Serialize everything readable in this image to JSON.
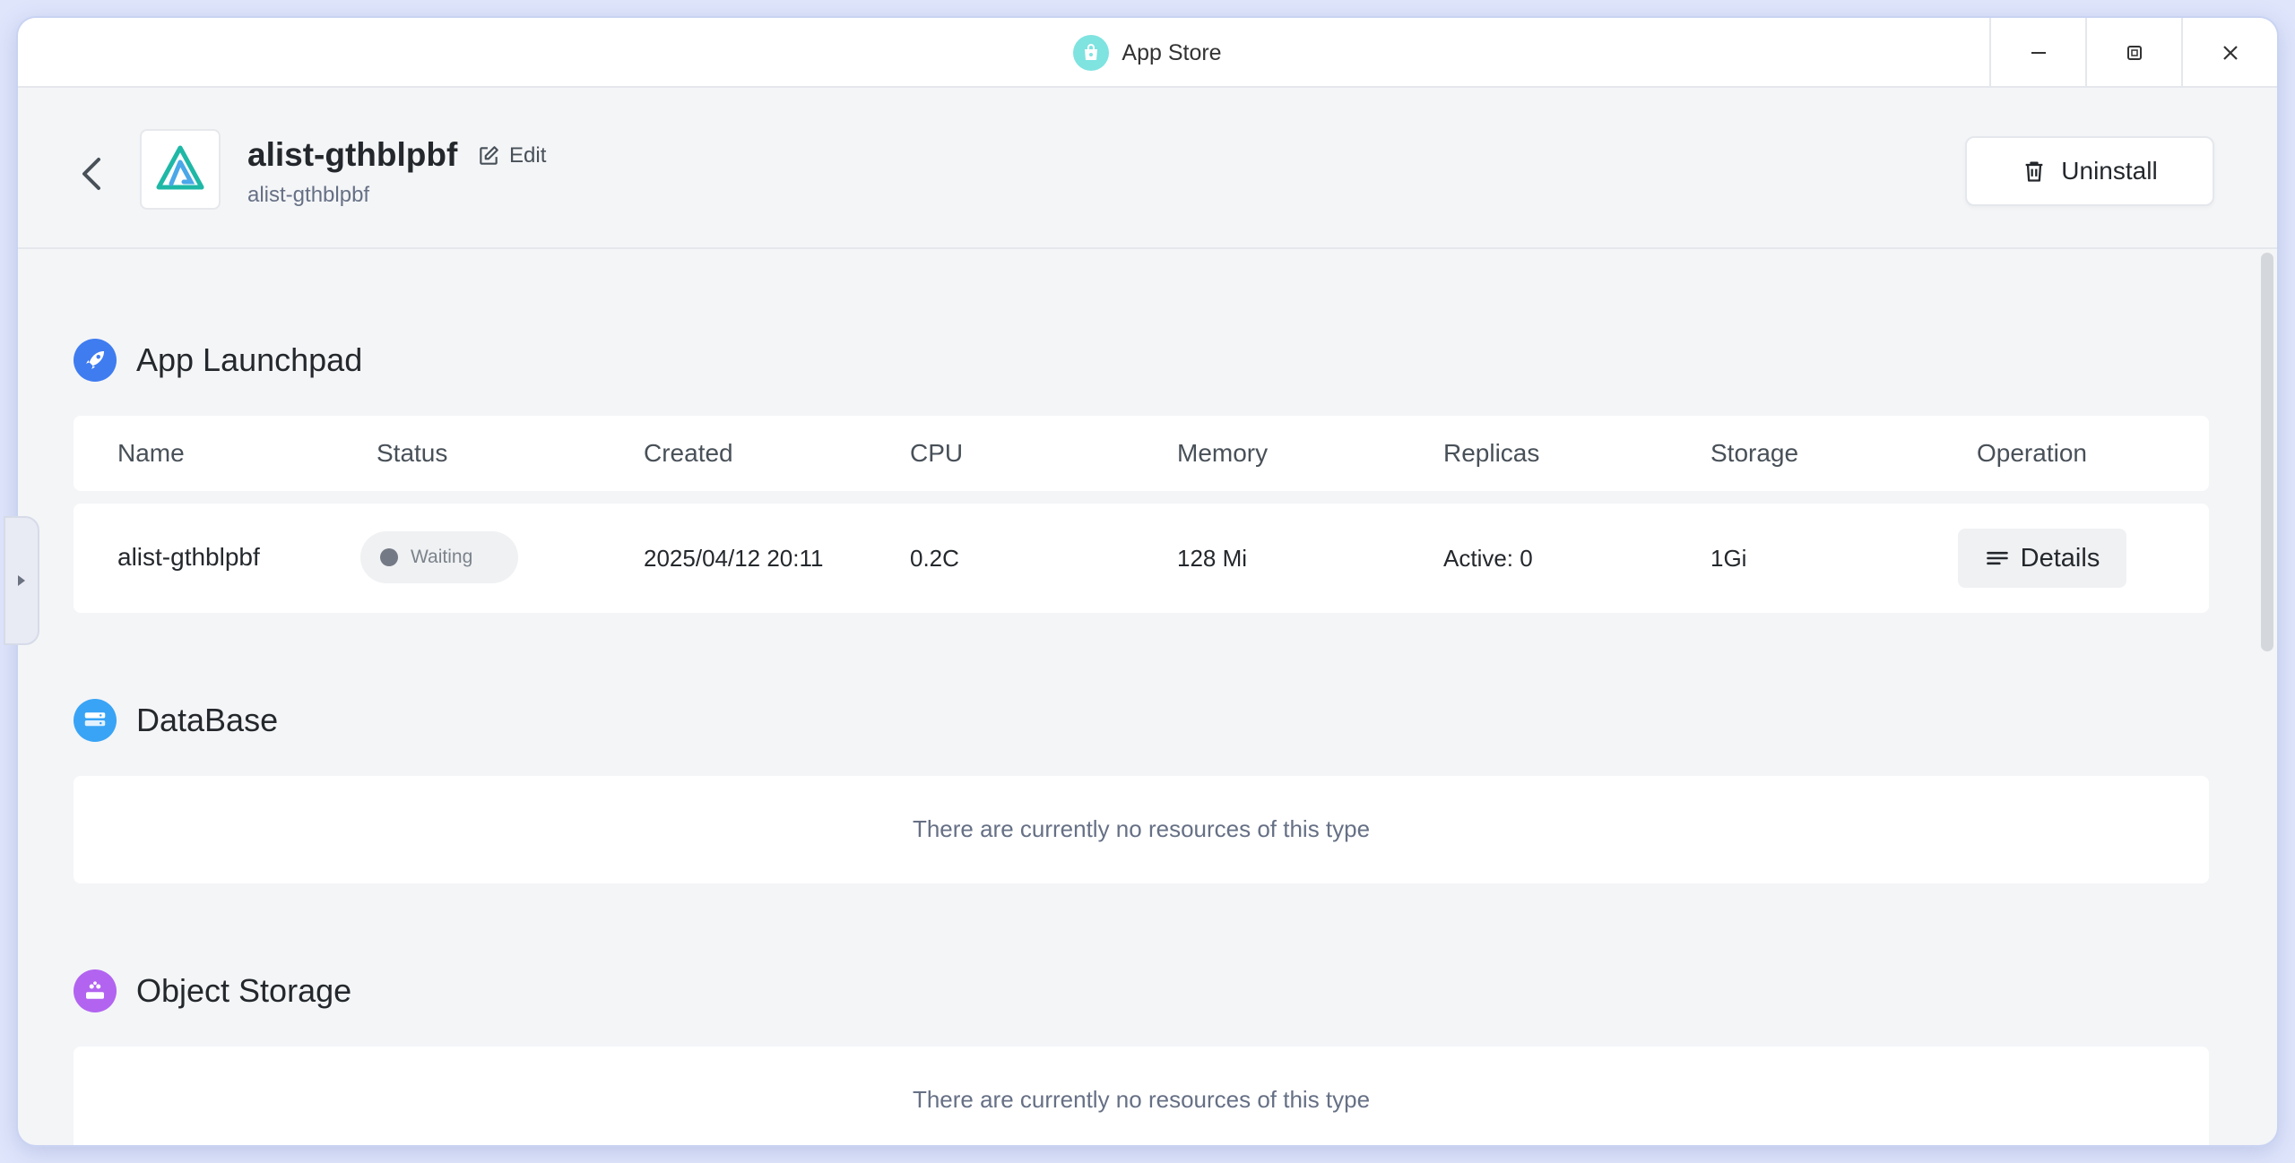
{
  "window": {
    "title": "App Store"
  },
  "header": {
    "app_name": "alist-gthblpbf",
    "edit_label": "Edit",
    "subtitle": "alist-gthblpbf",
    "uninstall_label": "Uninstall"
  },
  "launchpad": {
    "title": "App Launchpad",
    "columns": [
      "Name",
      "Status",
      "Created",
      "CPU",
      "Memory",
      "Replicas",
      "Storage",
      "Operation"
    ],
    "rows": [
      {
        "name": "alist-gthblpbf",
        "status": "Waiting",
        "created": "2025/04/12 20:11",
        "cpu": "0.2C",
        "memory": "128 Mi",
        "replicas": "Active: 0",
        "storage": "1Gi",
        "operation": "Details"
      }
    ]
  },
  "database": {
    "title": "DataBase",
    "empty": "There are currently no resources of this type"
  },
  "object_storage": {
    "title": "Object Storage",
    "empty": "There are currently no resources of this type"
  },
  "colors": {
    "launchpad_icon": "#3f7cf0",
    "database_icon": "#39a4f5",
    "object_storage_icon": "#b264f0",
    "app_logo_bg": "#7fe3e0"
  },
  "icons": [
    "app-store-icon",
    "minimize-icon",
    "maximize-icon",
    "close-icon",
    "back-icon",
    "edit-icon",
    "trash-icon",
    "rocket-icon",
    "database-icon",
    "object-storage-icon",
    "details-icon",
    "expand-arrow-icon"
  ]
}
